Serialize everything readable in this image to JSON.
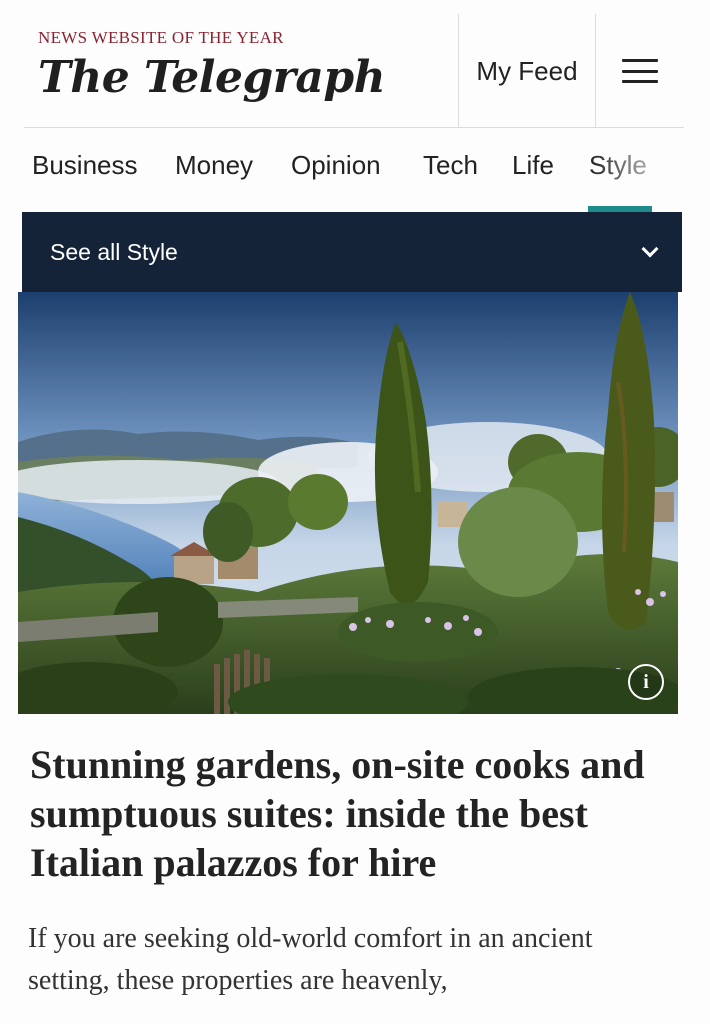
{
  "header": {
    "tagline": "NEWS WEBSITE OF THE YEAR",
    "masthead": "The Telegraph",
    "my_feed_label": "My Feed",
    "menu_icon": "hamburger-menu-icon"
  },
  "nav": {
    "items": [
      {
        "label": "Business"
      },
      {
        "label": "Money"
      },
      {
        "label": "Opinion"
      },
      {
        "label": "Tech"
      },
      {
        "label": "Life"
      },
      {
        "label": "Style"
      }
    ],
    "active": "Style",
    "accent_color": "#1e8a8a"
  },
  "section_bar": {
    "label": "See all Style",
    "icon": "chevron-down-icon",
    "background": "#142338"
  },
  "hero": {
    "info_icon": "info-icon",
    "info_glyph": "i"
  },
  "article": {
    "headline": "Stunning gardens, on-site cooks and sumptuous suites: inside the best Italian palazzos for hire",
    "standfirst": "If you are seeking old-world comfort in an ancient setting, these properties are heavenly,"
  },
  "colors": {
    "tagline": "#8a2330",
    "text": "#232323"
  }
}
